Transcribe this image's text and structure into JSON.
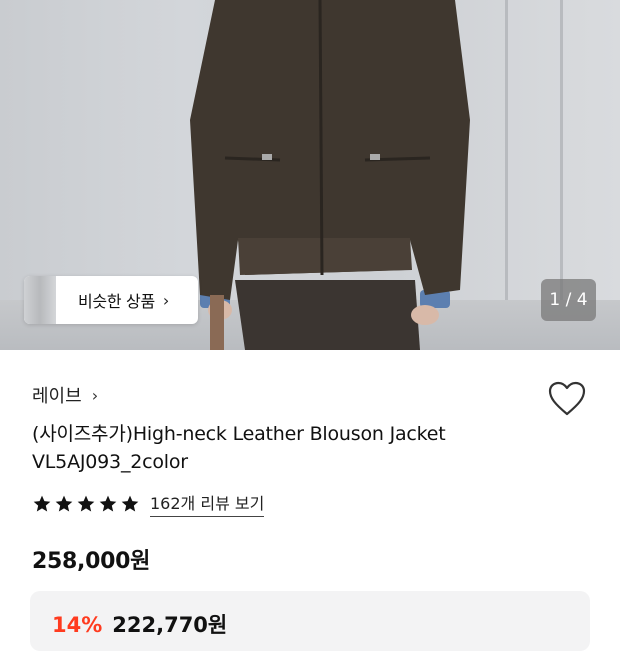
{
  "hero": {
    "similar_label": "비슷한 상품",
    "similar_arrow": "›",
    "counter": "1 / 4"
  },
  "product": {
    "brand": "레이브",
    "brand_arrow": "›",
    "title_line1": "(사이즈추가)High-neck Leather Blouson Jacket",
    "title_line2": "VL5AJ093_2color",
    "rating": 5,
    "review_link": "162개 리뷰 보기",
    "price": "258,000원"
  },
  "coupon": {
    "discount": "14%",
    "sale_price": "222,770원"
  },
  "colors": {
    "accent_red": "#ff3b1f"
  },
  "icons": {
    "heart": "heart-icon",
    "star": "star-icon"
  }
}
